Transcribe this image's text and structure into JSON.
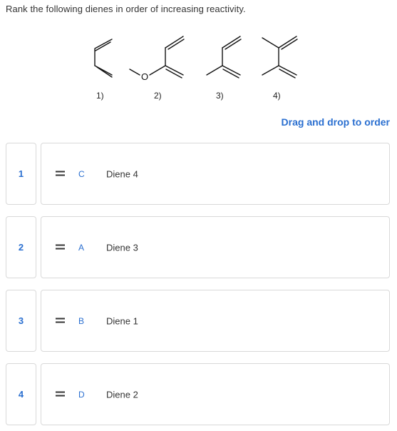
{
  "question": "Rank the following dienes in order of increasing reactivity.",
  "molecule_labels": [
    "1)",
    "2)",
    "3)",
    "4)"
  ],
  "hint": "Drag and drop to order",
  "accent_color": "#2a6fd0",
  "rows": [
    {
      "rank": "1",
      "letter": "C",
      "label": "Diene 4"
    },
    {
      "rank": "2",
      "letter": "A",
      "label": "Diene 3"
    },
    {
      "rank": "3",
      "letter": "B",
      "label": "Diene 1"
    },
    {
      "rank": "4",
      "letter": "D",
      "label": "Diene 2"
    }
  ],
  "molecules": {
    "oxygen_symbol": "O"
  }
}
